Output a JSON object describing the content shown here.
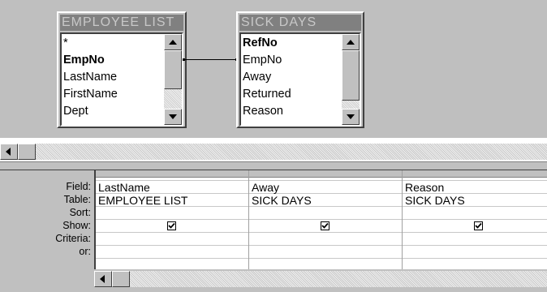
{
  "tables": [
    {
      "title": "EMPLOYEE LIST",
      "fields": [
        {
          "label": "*",
          "bold": false
        },
        {
          "label": "EmpNo",
          "bold": true
        },
        {
          "label": "LastName",
          "bold": false
        },
        {
          "label": "FirstName",
          "bold": false
        },
        {
          "label": "Dept",
          "bold": false
        }
      ]
    },
    {
      "title": "SICK DAYS",
      "fields": [
        {
          "label": "RefNo",
          "bold": true
        },
        {
          "label": "EmpNo",
          "bold": false
        },
        {
          "label": "Away",
          "bold": false
        },
        {
          "label": "Returned",
          "bold": false
        },
        {
          "label": "Reason",
          "bold": false
        }
      ]
    }
  ],
  "grid": {
    "row_labels": {
      "field": "Field:",
      "table": "Table:",
      "sort": "Sort:",
      "show": "Show:",
      "criteria": "Criteria:",
      "or": "or:"
    },
    "columns": [
      {
        "field": "LastName",
        "table": "EMPLOYEE LIST",
        "show": true
      },
      {
        "field": "Away",
        "table": "SICK DAYS",
        "show": true
      },
      {
        "field": "Reason",
        "table": "SICK DAYS",
        "show": true
      }
    ]
  },
  "icons": {
    "scroll_up": "triangle-up-icon",
    "scroll_down": "triangle-down-icon",
    "scroll_left": "triangle-left-icon",
    "checkbox": "checkmark-icon"
  },
  "colors": {
    "title_bar": "#808080",
    "title_text": "#c8c8c8",
    "panel": "#c0c0c0"
  }
}
